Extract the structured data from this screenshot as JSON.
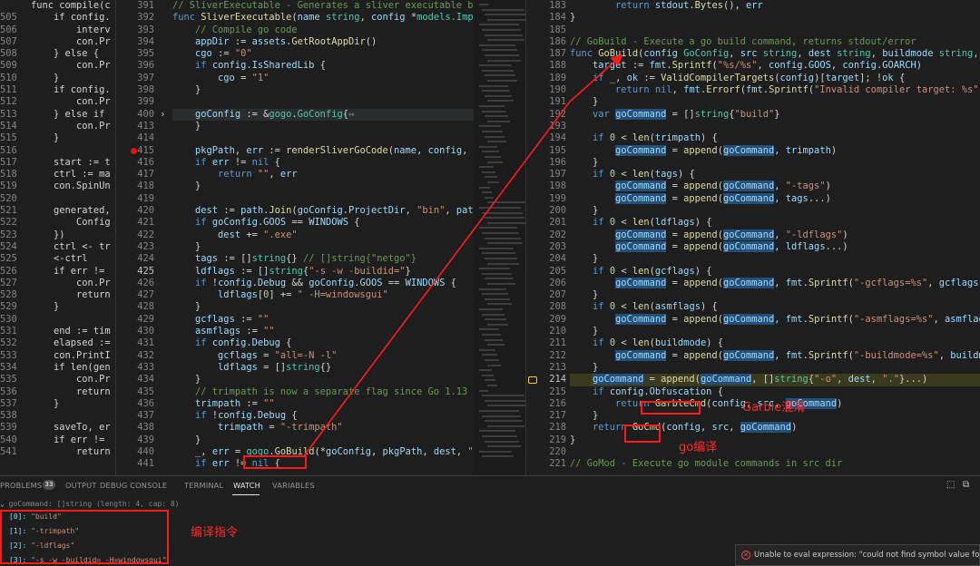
{
  "left_pane": {
    "lines": [
      {
        "n": "",
        "t": "func compile(c"
      },
      {
        "n": "505",
        "t": "    if config."
      },
      {
        "n": "506",
        "t": "        interv"
      },
      {
        "n": "507",
        "t": "        con.Pr"
      },
      {
        "n": "508",
        "t": "    } else {"
      },
      {
        "n": "509",
        "t": "        con.Pr"
      },
      {
        "n": "510",
        "t": "    }"
      },
      {
        "n": "511",
        "t": "    if config."
      },
      {
        "n": "512",
        "t": "        con.Pr"
      },
      {
        "n": "513",
        "t": "    } else if"
      },
      {
        "n": "514",
        "t": "        con.Pr"
      },
      {
        "n": "515",
        "t": "    }"
      },
      {
        "n": "516",
        "t": ""
      },
      {
        "n": "517",
        "t": "    start := t"
      },
      {
        "n": "518",
        "t": "    ctrl := ma"
      },
      {
        "n": "519",
        "t": "    con.SpinUn"
      },
      {
        "n": "520",
        "t": ""
      },
      {
        "n": "521",
        "t": "    generated,"
      },
      {
        "n": "522",
        "t": "        Config"
      },
      {
        "n": "523",
        "t": "    })"
      },
      {
        "n": "524",
        "t": "    ctrl <- tr"
      },
      {
        "n": "525",
        "t": "    <-ctrl"
      },
      {
        "n": "526",
        "t": "    if err !="
      },
      {
        "n": "527",
        "t": "        con.Pr"
      },
      {
        "n": "528",
        "t": "        return"
      },
      {
        "n": "529",
        "t": "    }"
      },
      {
        "n": "530",
        "t": ""
      },
      {
        "n": "531",
        "t": "    end := tim"
      },
      {
        "n": "532",
        "t": "    elapsed :="
      },
      {
        "n": "533",
        "t": "    con.PrintI"
      },
      {
        "n": "534",
        "t": "    if len(gen"
      },
      {
        "n": "535",
        "t": "        con.Pr"
      },
      {
        "n": "536",
        "t": "        return"
      },
      {
        "n": "537",
        "t": "    }"
      },
      {
        "n": "538",
        "t": ""
      },
      {
        "n": "539",
        "t": "    saveTo, er"
      },
      {
        "n": "540",
        "t": "    if err !="
      },
      {
        "n": "541",
        "t": "        return"
      }
    ]
  },
  "mid_pane": {
    "lines": [
      {
        "n": "391",
        "h": "<span class=\"cm\">// SliverExecutable - Generates a sliver executable bina</span>"
      },
      {
        "n": "392",
        "h": "<span class=\"kw\">func</span> <span class=\"fn\">SliverExecutable</span>(<span class=\"var\">name</span> <span class=\"ty\">string</span>, <span class=\"var\">config</span> *<span class=\"ty\">models.Implan</span>"
      },
      {
        "n": "393",
        "h": "    <span class=\"cm\">// Compile go code</span>"
      },
      {
        "n": "394",
        "h": "    <span class=\"var\">appDir</span> := <span class=\"var\">assets</span>.<span class=\"fn\">GetRootAppDir</span>()"
      },
      {
        "n": "395",
        "h": "    <span class=\"var\">cgo</span> := <span class=\"str\">\"0\"</span>"
      },
      {
        "n": "396",
        "h": "    <span class=\"kw\">if</span> <span class=\"var\">config</span>.<span class=\"var\">IsSharedLib</span> {"
      },
      {
        "n": "397",
        "h": "        <span class=\"var\">cgo</span> = <span class=\"str\">\"1\"</span>"
      },
      {
        "n": "398",
        "h": "    }"
      },
      {
        "n": "399",
        "h": ""
      },
      {
        "n": "400",
        "h": "    <span class=\"var\">goConfig</span> := &amp;<span class=\"ty\">gogo</span>.<span class=\"ty\">GoConfig</span>{<span style=\"color:#858585\">↔</span>",
        "fold": true
      },
      {
        "n": "413",
        "h": "    }"
      },
      {
        "n": "414",
        "h": ""
      },
      {
        "n": "415",
        "h": "    <span class=\"var\">pkgPath</span>, <span class=\"var\">err</span> := <span class=\"fn\">renderSliverGoCode</span>(<span class=\"var\">name</span>, <span class=\"var\">config</span>, <span class=\"var\">goC</span>",
        "bp": true
      },
      {
        "n": "416",
        "h": "    <span class=\"kw\">if</span> <span class=\"var\">err</span> != <span class=\"kw\">nil</span> {"
      },
      {
        "n": "417",
        "h": "        <span class=\"kw\">return</span> <span class=\"str\">\"\"</span>, <span class=\"var\">err</span>"
      },
      {
        "n": "418",
        "h": "    }"
      },
      {
        "n": "419",
        "h": ""
      },
      {
        "n": "420",
        "h": "    <span class=\"var\">dest</span> := <span class=\"var\">path</span>.<span class=\"fn\">Join</span>(<span class=\"var\">goConfig</span>.<span class=\"var\">ProjectDir</span>, <span class=\"str\">\"bin\"</span>, <span class=\"var\">path</span>.<span class=\"fn\">B</span>"
      },
      {
        "n": "421",
        "h": "    <span class=\"kw\">if</span> <span class=\"var\">goConfig</span>.<span class=\"var\">GOOS</span> == <span class=\"var\">WINDOWS</span> {"
      },
      {
        "n": "422",
        "h": "        <span class=\"var\">dest</span> += <span class=\"str\">\".exe\"</span>"
      },
      {
        "n": "423",
        "h": "    }"
      },
      {
        "n": "424",
        "h": "    <span class=\"var\">tags</span> := []<span class=\"ty\">string</span>{} <span class=\"cm\">// []string{\"netgo\"}</span>"
      },
      {
        "n": "425",
        "h": "    <span class=\"var\">ldflags</span> := []<span class=\"ty\">string</span>{<span class=\"str\">\"-s -w -buildid=\"</span>}",
        "cur": true
      },
      {
        "n": "426",
        "h": "    <span class=\"kw\">if</span> !<span class=\"var\">config</span>.<span class=\"var\">Debug</span> &amp;&amp; <span class=\"var\">goConfig</span>.<span class=\"var\">GOOS</span> == <span class=\"var\">WINDOWS</span> {"
      },
      {
        "n": "427",
        "h": "        <span class=\"var\">ldflags</span>[<span class=\"num\">0</span>] += <span class=\"str\">\" -H=windowsgui\"</span>"
      },
      {
        "n": "428",
        "h": "    }"
      },
      {
        "n": "429",
        "h": "    <span class=\"var\">gcflags</span> := <span class=\"str\">\"\"</span>"
      },
      {
        "n": "430",
        "h": "    <span class=\"var\">asmflags</span> := <span class=\"str\">\"\"</span>"
      },
      {
        "n": "431",
        "h": "    <span class=\"kw\">if</span> <span class=\"var\">config</span>.<span class=\"var\">Debug</span> {"
      },
      {
        "n": "432",
        "h": "        <span class=\"var\">gcflags</span> = <span class=\"str\">\"all=-N -l\"</span>"
      },
      {
        "n": "433",
        "h": "        <span class=\"var\">ldflags</span> = []<span class=\"ty\">string</span>{}"
      },
      {
        "n": "434",
        "h": "    }"
      },
      {
        "n": "435",
        "h": "    <span class=\"cm\">// trimpath is now a separate flag since Go 1.13</span>"
      },
      {
        "n": "436",
        "h": "    <span class=\"var\">trimpath</span> := <span class=\"str\">\"\"</span>"
      },
      {
        "n": "437",
        "h": "    <span class=\"kw\">if</span> !<span class=\"var\">config</span>.<span class=\"var\">Debug</span> {"
      },
      {
        "n": "438",
        "h": "        <span class=\"var\">trimpath</span> = <span class=\"str\">\"-trimpath\"</span>"
      },
      {
        "n": "439",
        "h": "    }"
      },
      {
        "n": "440",
        "h": "    <span class=\"var\">_</span>, <span class=\"var\">err</span> = <span class=\"ty\">gogo</span>.<span class=\"fn\">GoBuild</span>(*<span class=\"var\">goConfig</span>, <span class=\"var\">pkgPath</span>, <span class=\"var\">dest</span>, <span class=\"str\">\"\"</span>,"
      },
      {
        "n": "441",
        "h": "    <span class=\"kw\">if</span> <span class=\"var\">err</span> != <span class=\"kw\">nil</span> {"
      }
    ]
  },
  "right_pane": {
    "lines": [
      {
        "n": "183",
        "h": "        <span class=\"kw\">return</span> <span class=\"var\">stdout</span>.<span class=\"fn\">Bytes</span>(), <span class=\"var\">err</span>"
      },
      {
        "n": "184",
        "h": "}"
      },
      {
        "n": "185",
        "h": ""
      },
      {
        "n": "186",
        "h": "<span class=\"cm\">// GoBuild - Execute a go build command, returns stdout/error</span>"
      },
      {
        "n": "187",
        "h": "<span class=\"kw\">func</span> <span class=\"fn\">GoBuild</span>(<span class=\"var\">config</span> <span class=\"ty\">GoConfig</span>, <span class=\"var\">src</span> <span class=\"ty\">string</span>, <span class=\"var\">dest</span> <span class=\"ty\">string</span>, <span class=\"var\">buildmode</span> <span class=\"ty\">string</span>, <span class=\"var\">t</span>"
      },
      {
        "n": "188",
        "h": "    <span class=\"var\">target</span> := <span class=\"var\">fmt</span>.<span class=\"fn\">Sprintf</span>(<span class=\"str\">\"%s/%s\"</span>, <span class=\"var\">config</span>.<span class=\"var\">GOOS</span>, <span class=\"var\">config</span>.<span class=\"var\">GOARCH</span>)"
      },
      {
        "n": "189",
        "h": "    <span class=\"kw\">if</span> <span class=\"var\">_</span>, <span class=\"var\">ok</span> := <span class=\"fn\">ValidCompilerTargets</span>(<span class=\"var\">config</span>)[<span class=\"var\">target</span>]; !<span class=\"var\">ok</span> {"
      },
      {
        "n": "190",
        "h": "        <span class=\"kw\">return</span> <span class=\"kw\">nil</span>, <span class=\"var\">fmt</span>.<span class=\"fn\">Errorf</span>(<span class=\"var\">fmt</span>.<span class=\"fn\">Sprintf</span>(<span class=\"str\">\"Invalid compiler target: %s\"</span>,"
      },
      {
        "n": "191",
        "h": "    }"
      },
      {
        "n": "192",
        "h": "    <span class=\"kw\">var</span> <span class=\"hl-var\">goCommand</span> = []<span class=\"ty\">string</span>{<span class=\"str\">\"build\"</span>}"
      },
      {
        "n": "193",
        "h": ""
      },
      {
        "n": "194",
        "h": "    <span class=\"kw\">if</span> <span class=\"num\">0</span> &lt; <span class=\"fn\">len</span>(<span class=\"var\">trimpath</span>) {"
      },
      {
        "n": "195",
        "h": "        <span class=\"hl-var\">goCommand</span> = <span class=\"fn\">append</span>(<span class=\"hl-var\">goCommand</span>, <span class=\"var\">trimpath</span>)"
      },
      {
        "n": "196",
        "h": "    }"
      },
      {
        "n": "197",
        "h": "    <span class=\"kw\">if</span> <span class=\"num\">0</span> &lt; <span class=\"fn\">len</span>(<span class=\"var\">tags</span>) {"
      },
      {
        "n": "198",
        "h": "        <span class=\"hl-var\">goCommand</span> = <span class=\"fn\">append</span>(<span class=\"hl-var\">goCommand</span>, <span class=\"str\">\"-tags\"</span>)"
      },
      {
        "n": "199",
        "h": "        <span class=\"hl-var\">goCommand</span> = <span class=\"fn\">append</span>(<span class=\"hl-var\">goCommand</span>, <span class=\"var\">tags</span>...)"
      },
      {
        "n": "200",
        "h": "    }"
      },
      {
        "n": "201",
        "h": "    <span class=\"kw\">if</span> <span class=\"num\">0</span> &lt; <span class=\"fn\">len</span>(<span class=\"var\">ldflags</span>) {"
      },
      {
        "n": "202",
        "h": "        <span class=\"hl-var\">goCommand</span> = <span class=\"fn\">append</span>(<span class=\"hl-var\">goCommand</span>, <span class=\"str\">\"-ldflags\"</span>)"
      },
      {
        "n": "203",
        "h": "        <span class=\"hl-var\">goCommand</span> = <span class=\"fn\">append</span>(<span class=\"hl-var\">goCommand</span>, <span class=\"var\">ldflags</span>...)"
      },
      {
        "n": "204",
        "h": "    }"
      },
      {
        "n": "205",
        "h": "    <span class=\"kw\">if</span> <span class=\"num\">0</span> &lt; <span class=\"fn\">len</span>(<span class=\"var\">gcflags</span>) {"
      },
      {
        "n": "206",
        "h": "        <span class=\"hl-var\">goCommand</span> = <span class=\"fn\">append</span>(<span class=\"hl-var\">goCommand</span>, <span class=\"var\">fmt</span>.<span class=\"fn\">Sprintf</span>(<span class=\"str\">\"-gcflags=%s\"</span>, <span class=\"var\">gcflags</span>))"
      },
      {
        "n": "207",
        "h": "    }"
      },
      {
        "n": "208",
        "h": "    <span class=\"kw\">if</span> <span class=\"num\">0</span> &lt; <span class=\"fn\">len</span>(<span class=\"var\">asmflags</span>) {"
      },
      {
        "n": "209",
        "h": "        <span class=\"hl-var\">goCommand</span> = <span class=\"fn\">append</span>(<span class=\"hl-var\">goCommand</span>, <span class=\"var\">fmt</span>.<span class=\"fn\">Sprintf</span>(<span class=\"str\">\"-asmflags=%s\"</span>, <span class=\"var\">asmflags</span>"
      },
      {
        "n": "210",
        "h": "    }"
      },
      {
        "n": "211",
        "h": "    <span class=\"kw\">if</span> <span class=\"num\">0</span> &lt; <span class=\"fn\">len</span>(<span class=\"var\">buildmode</span>) {"
      },
      {
        "n": "212",
        "h": "        <span class=\"hl-var\">goCommand</span> = <span class=\"fn\">append</span>(<span class=\"hl-var\">goCommand</span>, <span class=\"var\">fmt</span>.<span class=\"fn\">Sprintf</span>(<span class=\"str\">\"-buildmode=%s\"</span>, <span class=\"var\">buildmo</span>"
      },
      {
        "n": "213",
        "h": "    }"
      },
      {
        "n": "214",
        "h": "    <span class=\"hl-var\">goCommand</span> = <span class=\"fn\">append</span>(<span class=\"hl-var\">goCommand</span>, []<span class=\"ty\">string</span>{<span class=\"str\">\"-o\"</span>, <span class=\"var\">dest</span>, <span class=\"str\">\".\"</span>}...)",
        "cur": true
      },
      {
        "n": "215",
        "h": "    <span class=\"kw\">if</span> <span class=\"var\">config</span>.<span class=\"var\">Obfuscation</span> {"
      },
      {
        "n": "216",
        "h": "        <span class=\"kw\">return</span> <span class=\"fn\">GarbleCmd</span>(<span class=\"var\">config</span>, <span class=\"var\">src</span>, <span class=\"hl-var\">goCommand</span>)"
      },
      {
        "n": "217",
        "h": "    }"
      },
      {
        "n": "218",
        "h": "    <span class=\"kw\">return</span> <span class=\"fn\">GoCmd</span>(<span class=\"var\">config</span>, <span class=\"var\">src</span>, <span class=\"hl-var\">goCommand</span>)"
      },
      {
        "n": "219",
        "h": "}"
      },
      {
        "n": "220",
        "h": ""
      },
      {
        "n": "221",
        "h": "<span class=\"cm\">// GoMod - Execute go module commands in src dir</span>"
      }
    ]
  },
  "panel": {
    "tabs": [
      "PROBLEMS",
      "OUTPUT",
      "DEBUG CONSOLE",
      "TERMINAL",
      "WATCH",
      "VARIABLES"
    ],
    "problems_count": "33",
    "watch_header": "goCommand: []string (length: 4, cap: 8)",
    "watch_items": [
      {
        "idx": "[0]:",
        "val": "\"build\""
      },
      {
        "idx": "[1]:",
        "val": "\"-trimpath\""
      },
      {
        "idx": "[2]:",
        "val": "\"-ldflags\""
      },
      {
        "idx": "[3]:",
        "val": "\"-s -w -buildid= -H=windowsgui\""
      }
    ]
  },
  "notification": {
    "text": "Unable to eval expression: \"could not find symbol value for le"
  },
  "annotations": {
    "garble_label": "Garble混淆",
    "go_label": "go编译",
    "command_label": "编译指令"
  },
  "colors": {
    "annotation_red": "#ff1a1a",
    "editor_bg": "#1e1e1e",
    "breakpoint": "#e51400"
  }
}
